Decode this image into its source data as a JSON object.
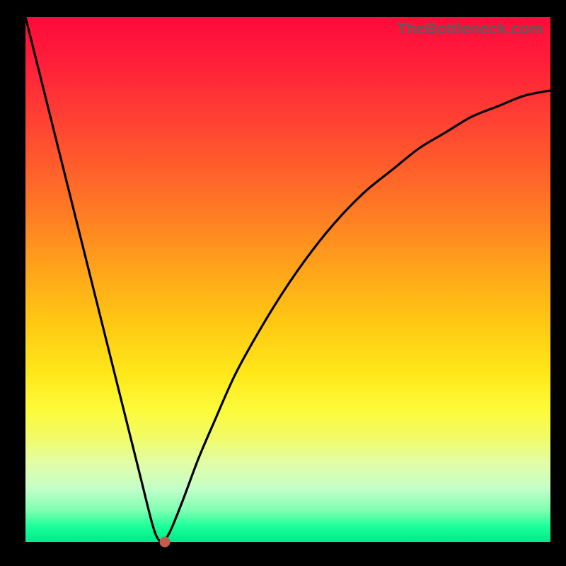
{
  "watermark": "TheBottleneck.com",
  "colors": {
    "frame": "#000000",
    "curve": "#000000",
    "dot": "#c7594f",
    "gradient_top": "#ff0a3a",
    "gradient_bottom": "#00ea89"
  },
  "chart_data": {
    "type": "line",
    "title": "",
    "xlabel": "",
    "ylabel": "",
    "xlim": [
      0,
      100
    ],
    "ylim": [
      0,
      100
    ],
    "grid": false,
    "legend": "none",
    "annotations": [],
    "series": [
      {
        "name": "bottleneck-curve",
        "x": [
          0,
          2,
          4,
          6,
          8,
          10,
          12,
          14,
          16,
          18,
          20,
          22,
          24,
          25,
          26,
          27,
          28,
          30,
          33,
          36,
          40,
          45,
          50,
          55,
          60,
          65,
          70,
          75,
          80,
          85,
          90,
          95,
          100
        ],
        "values": [
          100,
          92,
          84,
          76,
          68,
          60,
          52,
          44,
          36,
          28,
          20,
          12,
          4,
          1,
          0,
          1,
          3,
          8,
          16,
          23,
          32,
          41,
          49,
          56,
          62,
          67,
          71,
          75,
          78,
          81,
          83,
          85,
          86
        ]
      }
    ],
    "marker": {
      "x": 26.5,
      "y": 0
    }
  }
}
